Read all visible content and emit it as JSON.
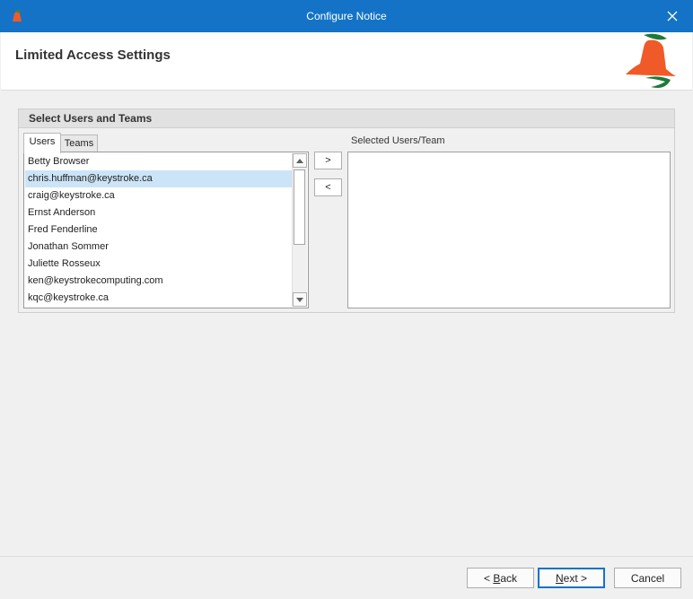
{
  "window": {
    "title": "Configure Notice",
    "close_icon": "close-icon"
  },
  "header": {
    "heading": "Limited Access Settings",
    "logo_icon": "bell-logo-icon"
  },
  "group": {
    "title": "Select Users and Teams"
  },
  "tabs": [
    {
      "label": "Users",
      "active": true
    },
    {
      "label": "Teams",
      "active": false
    }
  ],
  "users": {
    "items": [
      "Betty Browser",
      "chris.huffman@keystroke.ca",
      "craig@keystroke.ca",
      "Ernst Anderson",
      "Fred Fenderline",
      "Jonathan Sommer",
      "Juliette Rosseux",
      "ken@keystrokecomputing.com",
      "kqc@keystroke.ca"
    ],
    "selected_index": 1
  },
  "move": {
    "add_label": ">",
    "remove_label": "<"
  },
  "selected": {
    "label": "Selected Users/Team",
    "items": []
  },
  "footer": {
    "back_prefix": "< ",
    "back_key": "B",
    "back_rest": "ack",
    "next_key": "N",
    "next_rest": "ext >",
    "cancel_label": "Cancel"
  },
  "colors": {
    "titlebar": "#1473c6",
    "selection": "#cce4f7",
    "bell": "#f05a28",
    "leaf": "#1e7a3a"
  }
}
